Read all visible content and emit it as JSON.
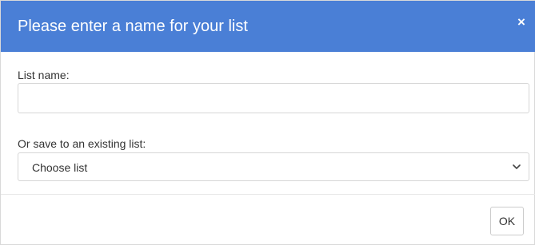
{
  "dialog": {
    "title": "Please enter a name for your list",
    "close_icon": "close-icon",
    "close_symbol": "×",
    "colors": {
      "header": "#4a7fd6",
      "header_text": "#ffffff",
      "border": "#d6d6d6"
    }
  },
  "form": {
    "list_name_label": "List name:",
    "list_name_value": "",
    "existing_list_label": "Or save to an existing list:",
    "existing_list_selected": "Choose list",
    "chevron_icon": "chevron-down-icon"
  },
  "footer": {
    "ok_label": "OK"
  }
}
